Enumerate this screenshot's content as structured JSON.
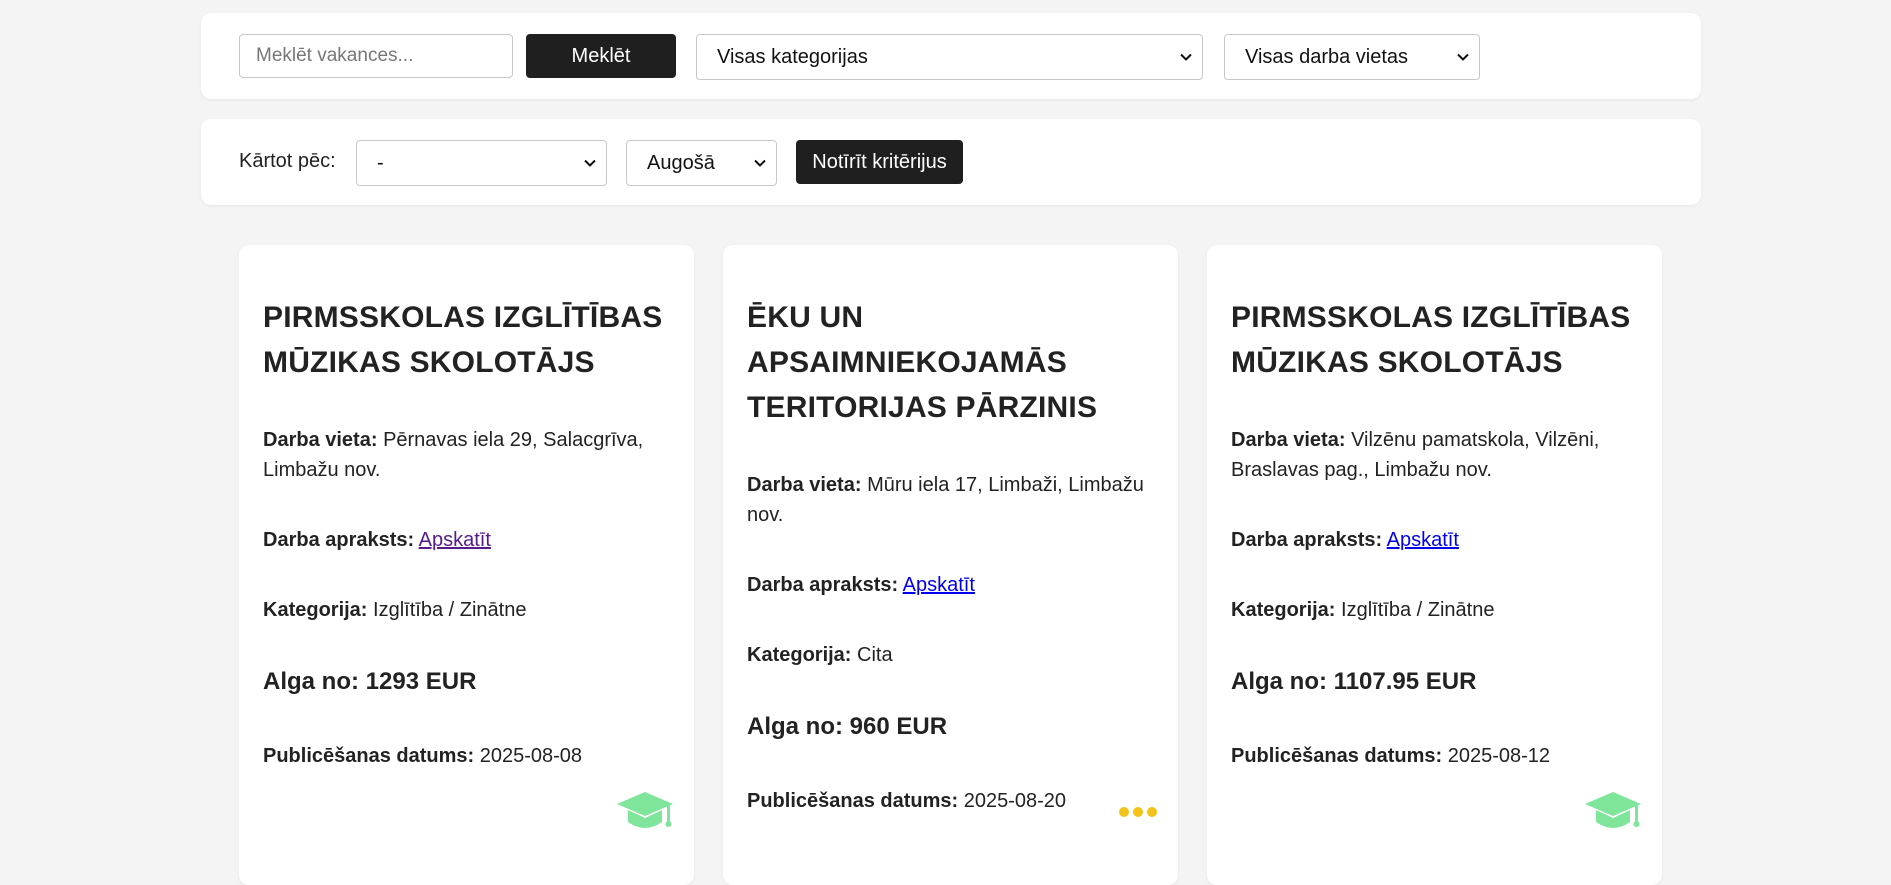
{
  "search": {
    "placeholder": "Meklēt vakances...",
    "value": "",
    "button_label": "Meklēt",
    "category_selected": "Visas kategorijas",
    "location_selected": "Visas darba vietas"
  },
  "sort": {
    "label": "Kārtot pēc:",
    "field_selected": "-",
    "order_selected": "Augošā",
    "clear_label": "Notīrīt kritērijus"
  },
  "labels": {
    "location": "Darba vieta:",
    "description": "Darba apraksts:",
    "category": "Kategorija:",
    "salary": "Alga no:",
    "published": "Publicēšanas datums:",
    "view_link": "Apskatīt"
  },
  "jobs": [
    {
      "title": "PIRMSSKOLAS IZGLĪTĪBAS MŪZIKAS SKOLOTĀJS",
      "location": "Pērnavas iela 29, Salacgrīva, Limbažu nov.",
      "category": "Izglītība / Zinātne",
      "salary": "1293 EUR",
      "published": "2025-08-08",
      "icon": "graduation-cap-icon",
      "icon_color": "#7ee59b",
      "link_visited": true
    },
    {
      "title": "ĒKU UN APSAIMNIEKOJAMĀS TERITORIJAS PĀRZINIS",
      "location": "Mūru iela 17, Limbaži, Limbažu nov.",
      "category": "Cita",
      "salary": "960 EUR",
      "published": "2025-08-20",
      "icon": "ellipsis-icon",
      "icon_color": "#f2c318",
      "link_visited": false
    },
    {
      "title": "PIRMSSKOLAS IZGLĪTĪBAS MŪZIKAS SKOLOTĀJS",
      "location": "Vilzēnu pamatskola, Vilzēni, Braslavas pag., Limbažu nov.",
      "category": "Izglītība / Zinātne",
      "salary": "1107.95 EUR",
      "published": "2025-08-12",
      "icon": "graduation-cap-icon",
      "icon_color": "#7ee59b",
      "link_visited": false
    }
  ],
  "colors": {
    "background": "#f4f4f4",
    "panel": "#ffffff",
    "button": "#1f1f1f",
    "link": "#0000ee",
    "link_visited": "#551a8b"
  }
}
